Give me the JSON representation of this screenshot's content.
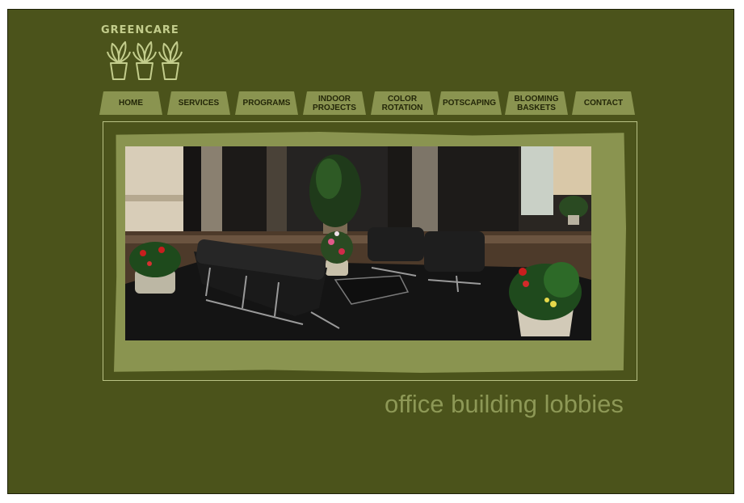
{
  "logo": {
    "brand": "GREENCARE",
    "icon": "three-potted-plants-icon"
  },
  "nav": {
    "tabs": [
      {
        "id": "home",
        "label": "HOME"
      },
      {
        "id": "services",
        "label": "SERVICES"
      },
      {
        "id": "programs",
        "label": "PROGRAMS"
      },
      {
        "id": "indoor-projects",
        "label": "INDOOR\nPROJECTS"
      },
      {
        "id": "color-rotation",
        "label": "COLOR\nROTATION"
      },
      {
        "id": "potscaping",
        "label": "POTSCAPING"
      },
      {
        "id": "blooming-baskets",
        "label": "BLOOMING\nBASKETS"
      },
      {
        "id": "contact",
        "label": "CONTACT"
      }
    ]
  },
  "main": {
    "photo_subject": "office building lobby with black leather seating and potted plants",
    "caption": "office building lobbies"
  },
  "colors": {
    "background": "#4b531b",
    "tab": "#8a9450",
    "tab_text": "#232608",
    "logo_text": "#c3cd8c",
    "caption": "#8d9856"
  }
}
